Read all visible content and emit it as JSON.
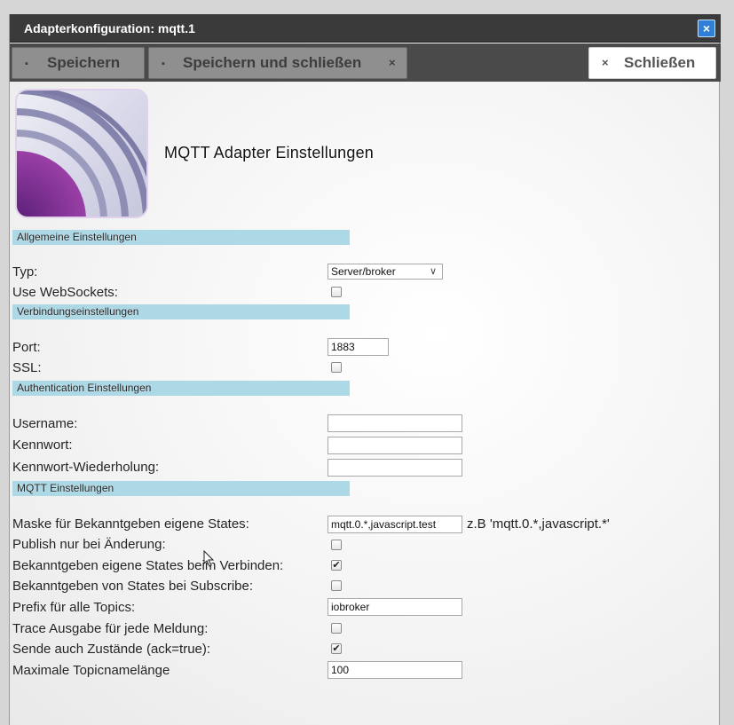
{
  "window": {
    "title": "Adapterkonfiguration: mqtt.1",
    "close_icon": "close-icon"
  },
  "toolbar": {
    "save_label": "Speichern",
    "save_close_label": "Speichern und schließen",
    "close_label": "Schließen"
  },
  "page_title": "MQTT Adapter Einstellungen",
  "sections": {
    "general": "Allgemeine Einstellungen",
    "connection": "Verbindungseinstellungen",
    "auth": "Authentication Einstellungen",
    "mqtt": "MQTT Einstellungen"
  },
  "general": {
    "type_label": "Typ:",
    "type_value": "Server/broker",
    "websockets_label": "Use WebSockets:",
    "websockets_checked": false
  },
  "connection": {
    "port_label": "Port:",
    "port_value": "1883",
    "ssl_label": "SSL:",
    "ssl_checked": false
  },
  "auth": {
    "username_label": "Username:",
    "username_value": "",
    "password_label": "Kennwort:",
    "password_value": "",
    "password_repeat_label": "Kennwort-Wiederholung:",
    "password_repeat_value": ""
  },
  "mqtt": {
    "mask_label": "Maske für Bekanntgeben eigene States:",
    "mask_value": "mqtt.0.*,javascript.test",
    "mask_hint": "z.B 'mqtt.0.*,javascript.*'",
    "publish_change_label": "Publish nur bei Änderung:",
    "publish_change_checked": false,
    "announce_connect_label": "Bekanntgeben eigene States beim Verbinden:",
    "announce_connect_checked": true,
    "announce_subscribe_label": "Bekanntgeben von States bei Subscribe:",
    "announce_subscribe_checked": false,
    "prefix_label": "Prefix für alle Topics:",
    "prefix_value": "iobroker",
    "trace_label": "Trace Ausgabe für jede Meldung:",
    "trace_checked": false,
    "send_ack_label": "Sende auch Zustände (ack=true):",
    "send_ack_checked": true,
    "max_topic_label": "Maximale Topicnamelänge",
    "max_topic_value": "100"
  },
  "colors": {
    "titlebar": "#3a3a3a",
    "toolbar": "#4a4a4a",
    "section_bg": "#add8e6",
    "close_button": "#2f7fd8"
  }
}
